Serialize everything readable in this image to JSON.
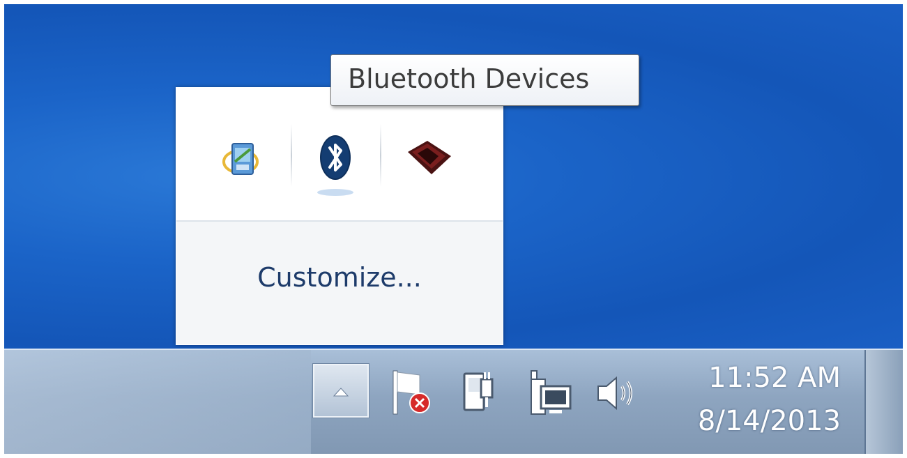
{
  "tooltip": {
    "text": "Bluetooth Devices"
  },
  "tray_popup": {
    "icons": [
      {
        "name": "network-adapter-icon"
      },
      {
        "name": "bluetooth-icon"
      },
      {
        "name": "app-tray-icon"
      }
    ],
    "customize_label": "Customize..."
  },
  "taskbar": {
    "show_hidden_icons": "chevron-up-icon",
    "tray_icons": [
      {
        "name": "action-center-flag-icon"
      },
      {
        "name": "power-plug-icon"
      },
      {
        "name": "network-icon"
      },
      {
        "name": "volume-icon"
      }
    ],
    "clock": {
      "time": "11:52 AM",
      "date": "8/14/2013"
    }
  },
  "colors": {
    "desktop": "#1b64c8",
    "taskbar": "#8ea5c0",
    "link": "#1d3b6a"
  }
}
